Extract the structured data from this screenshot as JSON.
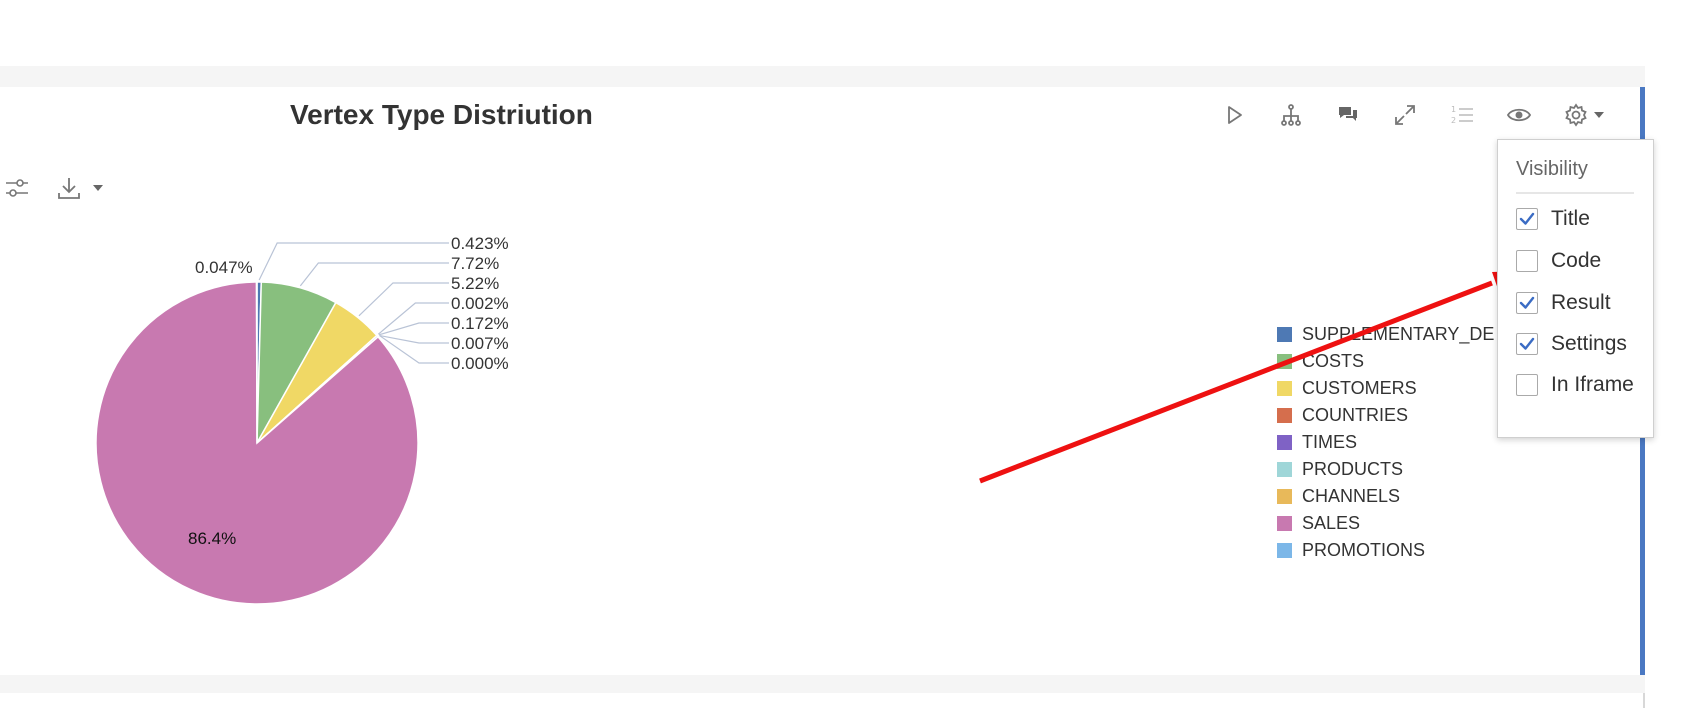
{
  "paragraph": {
    "title": "Vertex Type Distriution"
  },
  "toolbar": {
    "buttons": [
      {
        "name": "run-icon"
      },
      {
        "name": "hierarchy-icon"
      },
      {
        "name": "comments-icon"
      },
      {
        "name": "expand-icon"
      },
      {
        "name": "line-numbers-icon"
      },
      {
        "name": "visibility-icon"
      },
      {
        "name": "settings-icon"
      }
    ]
  },
  "chart_tools": [
    {
      "name": "chart-settings-icon"
    },
    {
      "name": "download-icon"
    }
  ],
  "visibility_menu": {
    "header": "Visibility",
    "items": [
      {
        "label": "Title",
        "checked": true
      },
      {
        "label": "Code",
        "checked": false
      },
      {
        "label": "Result",
        "checked": true
      },
      {
        "label": "Settings",
        "checked": true
      },
      {
        "label": "In Iframe",
        "checked": false
      }
    ]
  },
  "colors": {
    "accent": "#4a78c2",
    "checkmark": "#3b6cc4",
    "annotation_arrow": "#ee1111",
    "leader_lines": "#b9c3d6"
  },
  "chart_data": {
    "type": "pie",
    "title": "",
    "legend_position": "right",
    "slices": [
      {
        "name": "SUPPLEMENTARY_DE",
        "value": 0.423,
        "label": "0.423%",
        "color": "#4e79b4"
      },
      {
        "name": "COSTS",
        "value": 7.72,
        "label": "7.72%",
        "color": "#88bf7e"
      },
      {
        "name": "CUSTOMERS",
        "value": 5.22,
        "label": "5.22%",
        "color": "#f0d865"
      },
      {
        "name": "COUNTRIES",
        "value": 0.002,
        "label": "0.002%",
        "color": "#d56e4d"
      },
      {
        "name": "TIMES",
        "value": 0.172,
        "label": "0.172%",
        "color": "#7f62c5"
      },
      {
        "name": "PRODUCTS",
        "value": 0.007,
        "label": "0.007%",
        "color": "#9fd6d8"
      },
      {
        "name": "CHANNELS",
        "value": 0.0,
        "label": "0.000%",
        "color": "#e8b95a"
      },
      {
        "name": "SALES",
        "value": 86.4,
        "label": "86.4%",
        "color": "#c879b0"
      },
      {
        "name": "PROMOTIONS",
        "value": 0.047,
        "label": "0.047%",
        "color": "#7cb7e8"
      }
    ]
  }
}
